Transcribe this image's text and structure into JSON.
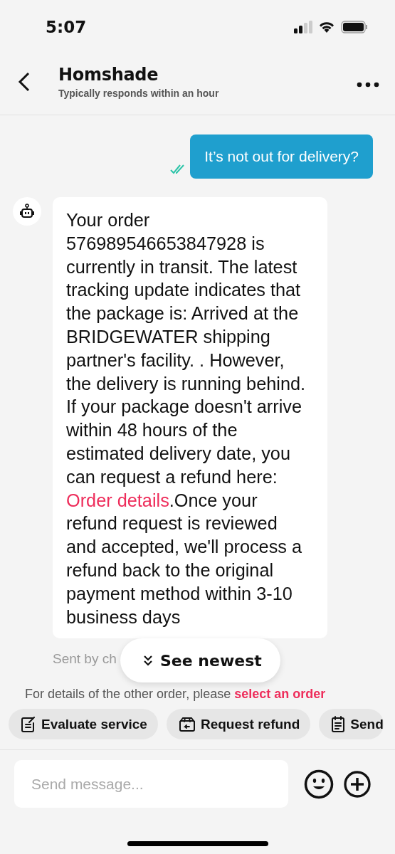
{
  "status_bar": {
    "time": "5:07"
  },
  "header": {
    "title": "Homshade",
    "subtitle": "Typically responds within an hour"
  },
  "messages": [
    {
      "kind": "outgoing",
      "text": "It’s not out for delivery?",
      "read": true
    },
    {
      "kind": "bot",
      "text_before": "Your order 576989546653847928 is currently in transit. The latest tracking update indicates that the package is: Arrived at the BRIDGEWATER shipping partner's facility. . However, the delivery is running behind. If your package doesn't arrive within 48 hours of the estimated delivery date, you can request a refund here: ",
      "link": "Order details",
      "text_after": ".Once your refund request is reviewed and accepted, we'll process a refund back to the original payment method within 3-10 business days",
      "footer": "Sent by ch"
    }
  ],
  "see_newest": {
    "label": "See newest"
  },
  "notice": {
    "text": "For details of the other order, please ",
    "link": "select an order"
  },
  "quick_actions": [
    {
      "kind": "evaluate",
      "label": "Evaluate service"
    },
    {
      "kind": "refund",
      "label": "Request refund"
    },
    {
      "kind": "send",
      "label": "Send"
    }
  ],
  "composer": {
    "placeholder": "Send message..."
  }
}
